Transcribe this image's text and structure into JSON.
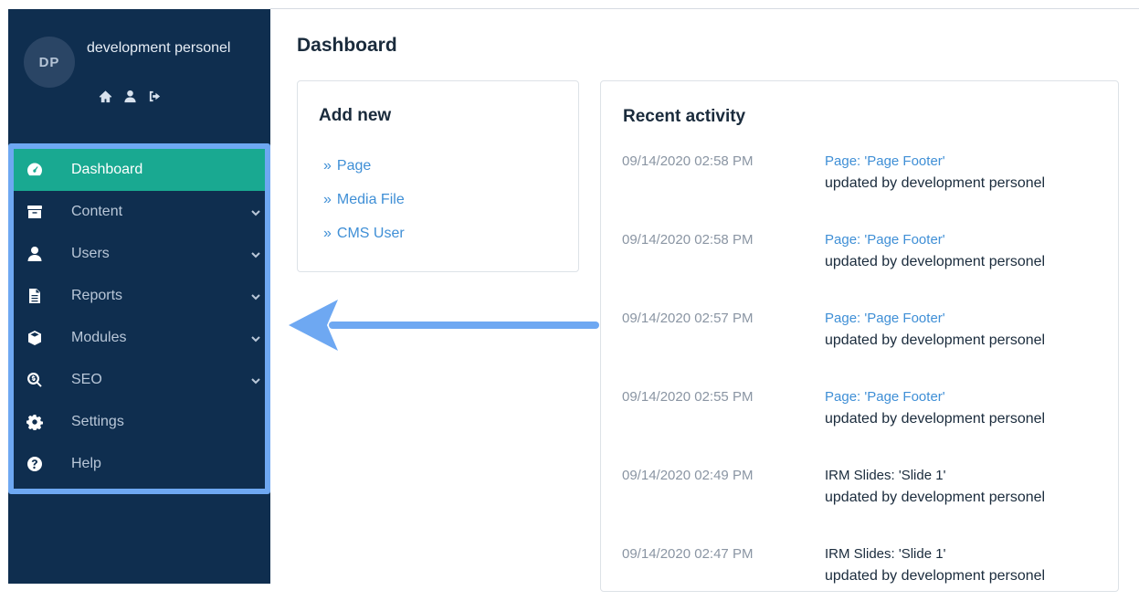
{
  "user": {
    "initials": "DP",
    "name": "development personel",
    "actions": [
      {
        "icon": "home-icon"
      },
      {
        "icon": "user-icon"
      },
      {
        "icon": "sign-out-icon"
      }
    ]
  },
  "nav": {
    "items": [
      {
        "label": "Dashboard",
        "icon": "dashboard-icon",
        "active": true,
        "has_submenu": false
      },
      {
        "label": "Content",
        "icon": "archive-icon",
        "active": false,
        "has_submenu": true
      },
      {
        "label": "Users",
        "icon": "user-icon",
        "active": false,
        "has_submenu": true
      },
      {
        "label": "Reports",
        "icon": "file-icon",
        "active": false,
        "has_submenu": true
      },
      {
        "label": "Modules",
        "icon": "cube-icon",
        "active": false,
        "has_submenu": true
      },
      {
        "label": "SEO",
        "icon": "search-dollar-icon",
        "active": false,
        "has_submenu": true
      },
      {
        "label": "Settings",
        "icon": "gear-icon",
        "active": false,
        "has_submenu": false
      },
      {
        "label": "Help",
        "icon": "question-circle-icon",
        "active": false,
        "has_submenu": false
      }
    ]
  },
  "main": {
    "title": "Dashboard",
    "add_new": {
      "title": "Add new",
      "links": [
        {
          "prefix": "»",
          "label": "Page"
        },
        {
          "prefix": "»",
          "label": "Media File"
        },
        {
          "prefix": "»",
          "label": "CMS User"
        }
      ]
    },
    "recent_activity": {
      "title": "Recent activity",
      "items": [
        {
          "date": "09/14/2020  02:58 PM",
          "title": "Page: 'Page Footer'",
          "link": true,
          "desc": "updated by development personel"
        },
        {
          "date": "09/14/2020  02:58 PM",
          "title": "Page: 'Page Footer'",
          "link": true,
          "desc": "updated by development personel"
        },
        {
          "date": "09/14/2020  02:57 PM",
          "title": "Page: 'Page Footer'",
          "link": true,
          "desc": "updated by development personel"
        },
        {
          "date": "09/14/2020  02:55 PM",
          "title": "Page: 'Page Footer'",
          "link": true,
          "desc": "updated by development personel"
        },
        {
          "date": "09/14/2020  02:49 PM",
          "title": "IRM Slides: 'Slide 1'",
          "link": false,
          "desc": "updated by development personel"
        },
        {
          "date": "09/14/2020  02:47 PM",
          "title": "IRM Slides: 'Slide 1'",
          "link": false,
          "desc": "updated by development personel"
        }
      ]
    }
  },
  "colors": {
    "sidebar_bg": "#0f2e4f",
    "active_item": "#19a991",
    "highlight_border": "#6ea8f2",
    "link": "#3f8fd6"
  }
}
